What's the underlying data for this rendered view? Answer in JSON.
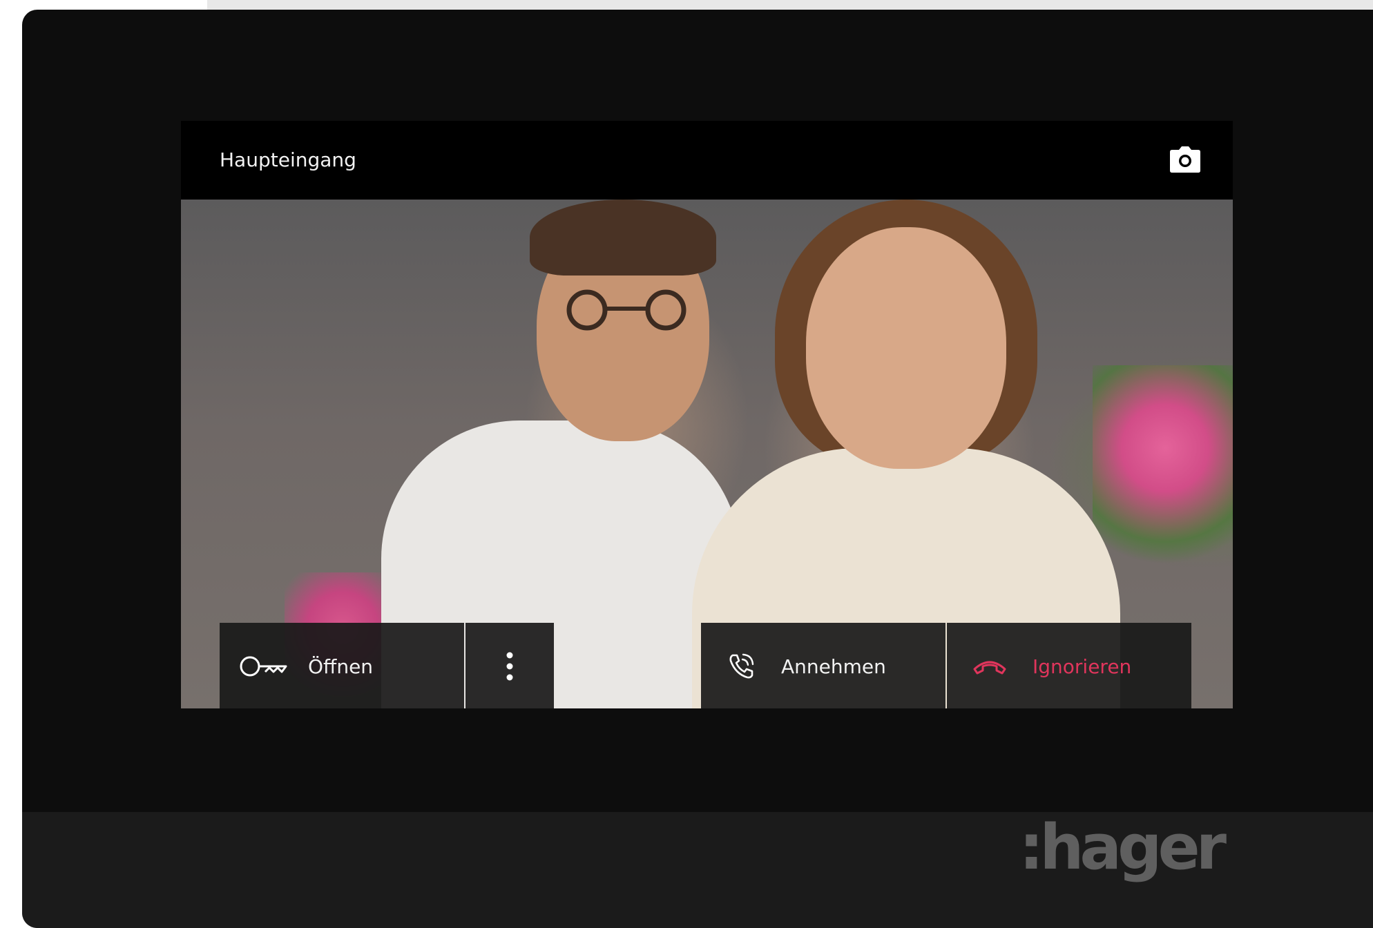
{
  "screen": {
    "title": "Haupteingang"
  },
  "actions": {
    "open_label": "Öffnen",
    "answer_label": "Annehmen",
    "ignore_label": "Ignorieren"
  },
  "brand": {
    "logo_text": ":hager"
  },
  "icons": {
    "camera": "camera-icon",
    "key": "key-icon",
    "more": "more-vertical-icon",
    "phone": "phone-icon",
    "hangup": "hangup-icon"
  },
  "colors": {
    "device_bezel": "#0d0d0d",
    "button_background": "#191919",
    "ignore_red": "#e0355c",
    "text_light": "#f2f2f2",
    "logo_gray": "#5f5f5f"
  }
}
